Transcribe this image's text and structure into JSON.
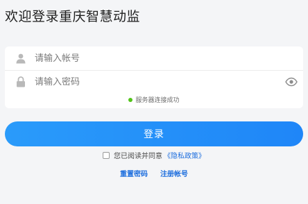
{
  "page": {
    "title": "欢迎登录重庆智慧动监"
  },
  "form": {
    "account_placeholder": "请输入帐号",
    "password_placeholder": "请输入密码",
    "account_value": "",
    "password_value": "",
    "status_text": "服务器连接成功",
    "status_color": "#52c41a"
  },
  "actions": {
    "login_label": "登录",
    "agree_prefix": "您已阅读并同意",
    "privacy_link": "《隐私政策》",
    "reset_password": "重置密码",
    "register_account": "注册帐号"
  },
  "theme": {
    "accent": "#1f86f8",
    "link": "#1f6fde"
  },
  "icons": {
    "account": "user-icon",
    "password": "lock-icon",
    "visibility": "eye-icon"
  }
}
